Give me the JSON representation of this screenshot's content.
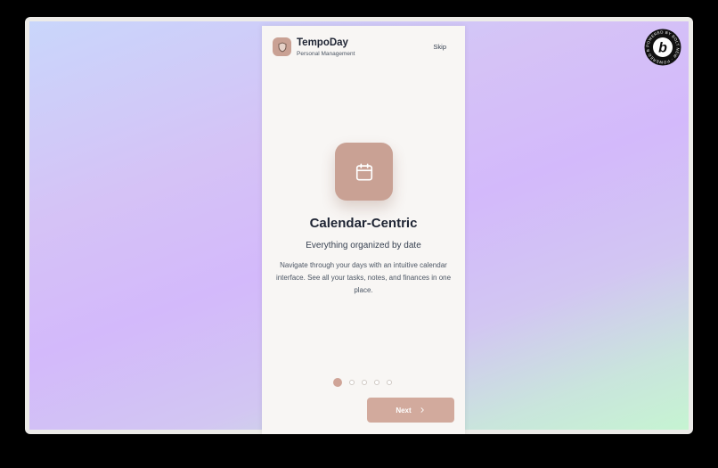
{
  "app": {
    "title": "TempoDay",
    "subtitle": "Personal Management",
    "skip_label": "Skip"
  },
  "slide": {
    "title": "Calendar-Centric",
    "subtitle": "Everything organized by date",
    "description": "Navigate through your days with an intuitive calendar interface. See all your tasks, notes, and finances in one place.",
    "icon": "calendar-icon"
  },
  "pagination": {
    "total": 5,
    "current": 1
  },
  "actions": {
    "next_label": "Next",
    "next_icon": "chevron-right-icon"
  },
  "badge": {
    "text": "POWERED BY BOLT NEW · POWERED BY BOLT NEW ·",
    "letter": "b"
  },
  "colors": {
    "accent": "#c9a194",
    "button": "#d2aa9d",
    "text_dark": "#1e2433",
    "phone_bg": "#f8f6f4"
  }
}
